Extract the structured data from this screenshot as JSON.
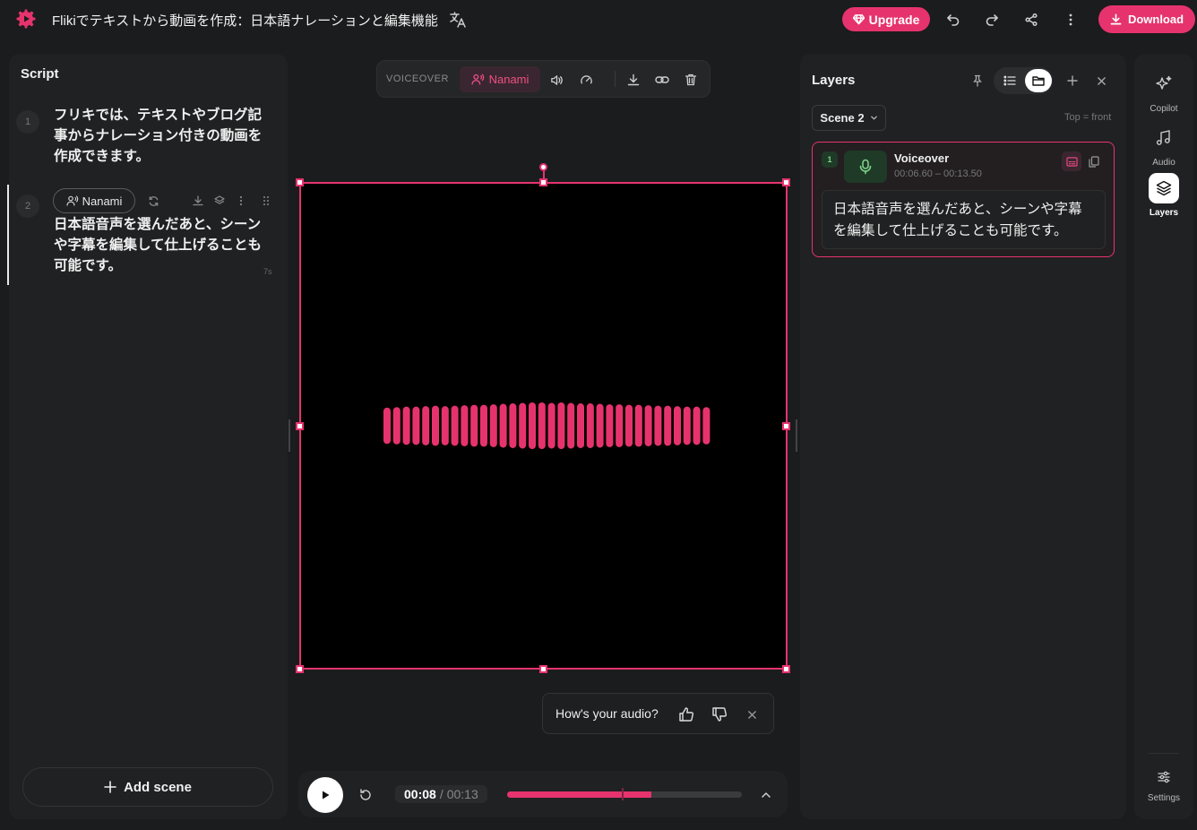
{
  "header": {
    "title": "Flikiでテキストから動画を作成：日本語ナレーションと編集機能",
    "upgrade_label": "Upgrade",
    "download_label": "Download"
  },
  "script_panel": {
    "title": "Script",
    "scenes": [
      {
        "number": "1",
        "text": "フリキでは、テキストやブログ記事からナレーション付きの動画を作成できます。"
      },
      {
        "number": "2",
        "voice": "Nanami",
        "text": "日本語音声を選んだあと、シーンや字幕を編集して仕上げることも可能です。",
        "duration": "7s"
      }
    ],
    "add_scene_label": "Add scene"
  },
  "voiceover_toolbar": {
    "label": "VOICEOVER",
    "voice": "Nanami"
  },
  "feedback": {
    "question": "How's your audio?"
  },
  "player": {
    "current_time": "00:08",
    "separator": "/",
    "total_time": "00:13",
    "progress": 0.615
  },
  "layers_panel": {
    "title": "Layers",
    "scene_select": "Scene 2",
    "order_hint": "Top = front",
    "layer": {
      "index": "1",
      "name": "Voiceover",
      "time_range": "00:06.60 – 00:13.50",
      "text": "日本語音声を選んだあと、シーンや字幕を編集して仕上げることも可能です。"
    }
  },
  "rail": {
    "items": [
      "Copilot",
      "Audio",
      "Layers"
    ],
    "settings_label": "Settings"
  },
  "colors": {
    "accent": "#e6336e",
    "background": "#1b1c1d",
    "panel": "#202122",
    "success": "#7ed38b"
  },
  "waveform_levels": [
    0.78,
    0.8,
    0.82,
    0.82,
    0.84,
    0.86,
    0.84,
    0.86,
    0.88,
    0.9,
    0.9,
    0.92,
    0.94,
    0.96,
    0.98,
    1.0,
    1.0,
    0.98,
    1.0,
    0.98,
    0.96,
    0.96,
    0.94,
    0.92,
    0.92,
    0.9,
    0.9,
    0.88,
    0.86,
    0.86,
    0.84,
    0.82,
    0.82,
    0.8
  ]
}
